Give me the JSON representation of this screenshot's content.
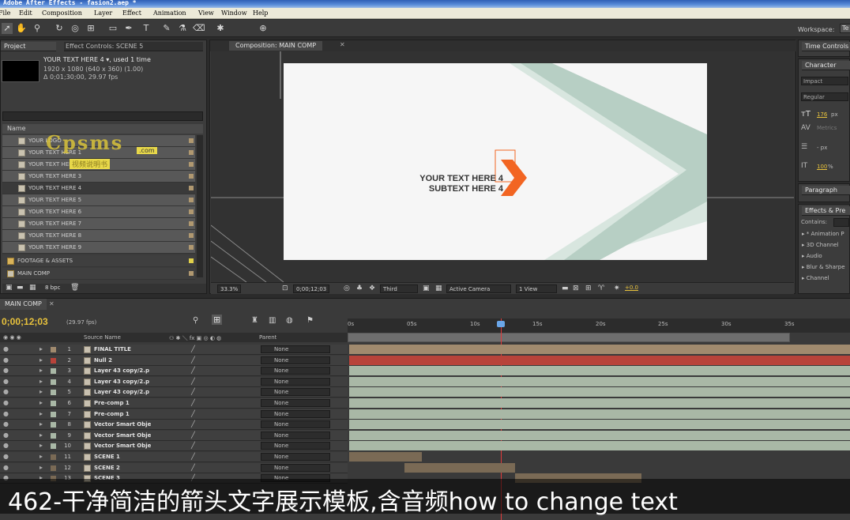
{
  "app": {
    "title": "Adobe After Effects - fasion2.aep *"
  },
  "menu": [
    "File",
    "Edit",
    "Composition",
    "Layer",
    "Effect",
    "Animation",
    "View",
    "Window",
    "Help"
  ],
  "toolbar": {
    "workspace_label": "Workspace:",
    "workspace_value": "Te"
  },
  "project": {
    "tab_label": "Project",
    "effect_tab_label": "Effect Controls: SCENE 5",
    "asset_name": "YOUR TEXT HERE 4",
    "asset_used": ", used 1 time",
    "asset_size": "1920 x 1080  (640 x 360) (1.00)",
    "asset_duration": "Δ 0;01;30;00, 29.97 fps",
    "name_header": "Name",
    "items": [
      "YOUR LOGO",
      "YOUR TEXT HERE 1",
      "YOUR TEXT HERE 2",
      "YOUR TEXT HERE 3",
      "YOUR TEXT HERE 4",
      "YOUR TEXT HERE 5",
      "YOUR TEXT HERE 6",
      "YOUR TEXT HERE 7",
      "YOUR TEXT HERE 8",
      "YOUR TEXT HERE 9"
    ],
    "folders": [
      "FOOTAGE & ASSETS",
      "MAIN COMP"
    ],
    "bpc": "8 bpc"
  },
  "watermark": {
    "logo": "Cpsms",
    "com": ".com",
    "cn": "视频说明书"
  },
  "composition": {
    "tab_label": "Composition: MAIN COMP",
    "line1": "YOUR TEXT HERE 4",
    "line2": "SUBTEXT HERE 4",
    "zoom": "33.3%",
    "timecode": "0;00;12;03",
    "resolution": "Third",
    "camera": "Active Camera",
    "views": "1 View",
    "exposure": "+0.0",
    "accent_color": "#f26522",
    "chevron_color": "#b7cfc4"
  },
  "right": {
    "time_controls": "Time Controls",
    "character": "Character",
    "font": "Impact",
    "style": "Regular",
    "font_size": "176",
    "font_size_unit": "px",
    "metrics": "Metrics",
    "leading_unit": "- px",
    "scale": "100",
    "scale_unit": "%",
    "paragraph": "Paragraph",
    "effects": "Effects & Pre",
    "contains": "Contains:",
    "effect_items": [
      "* Animation P",
      "3D Channel",
      "Audio",
      "Blur & Sharpe",
      "Channel"
    ]
  },
  "timeline": {
    "tab_label": "MAIN COMP",
    "timecode": "0;00;12;03",
    "fps": "(29.97 fps)",
    "col_source": "Source Name",
    "col_parent": "Parent",
    "ticks": [
      "0s",
      "05s",
      "10s",
      "15s",
      "20s",
      "25s",
      "30s",
      "35s"
    ],
    "layers": [
      {
        "num": "1",
        "name": "FINAL TITLE",
        "parent": "None",
        "color": "#a08a6e"
      },
      {
        "num": "2",
        "name": "Null 2",
        "parent": "None",
        "color": "#b8433a"
      },
      {
        "num": "3",
        "name": "Layer 43 copy/2.p",
        "parent": "None",
        "color": "#a9b8a6"
      },
      {
        "num": "4",
        "name": "Layer 43 copy/2.p",
        "parent": "None",
        "color": "#a9b8a6"
      },
      {
        "num": "5",
        "name": "Layer 43 copy/2.p",
        "parent": "None",
        "color": "#a9b8a6"
      },
      {
        "num": "6",
        "name": "Pre-comp 1",
        "parent": "None",
        "color": "#a9b8a6"
      },
      {
        "num": "7",
        "name": "Pre-comp 1",
        "parent": "None",
        "color": "#a9b8a6"
      },
      {
        "num": "8",
        "name": "Vector Smart Obje",
        "parent": "None",
        "color": "#a9b8a6"
      },
      {
        "num": "9",
        "name": "Vector Smart Obje",
        "parent": "None",
        "color": "#a9b8a6"
      },
      {
        "num": "10",
        "name": "Vector Smart Obje",
        "parent": "None",
        "color": "#a9b8a6"
      },
      {
        "num": "11",
        "name": "SCENE 1",
        "parent": "None",
        "color": "#7a6a55"
      },
      {
        "num": "12",
        "name": "SCENE 2",
        "parent": "None",
        "color": "#7a6a55"
      },
      {
        "num": "13",
        "name": "SCENE 3",
        "parent": "None",
        "color": "#7a6a55"
      }
    ]
  },
  "caption": "462-干净简洁的箭头文字展示模板,含音频how to change text"
}
